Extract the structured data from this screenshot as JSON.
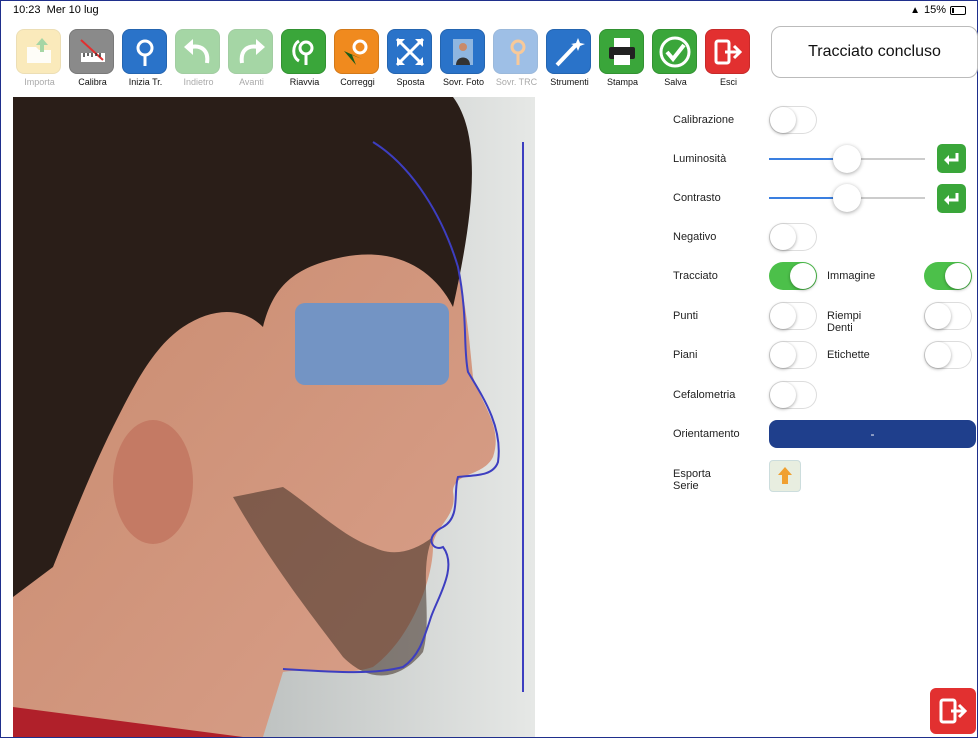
{
  "status": {
    "time": "10:23",
    "date": "Mer 10 lug",
    "wifi_icon": "wifi-icon",
    "battery": "15%"
  },
  "toolbar": [
    {
      "label": "Importa",
      "icon": "import-icon",
      "color": "#f5d26a",
      "enabled": false
    },
    {
      "label": "Calibra",
      "icon": "calibrate-ruler-icon",
      "color": "#8a8a8a",
      "enabled": true
    },
    {
      "label": "Inizia Tr.",
      "icon": "start-tracing-icon",
      "color": "#2a73c9",
      "enabled": true
    },
    {
      "label": "Indietro",
      "icon": "undo-arrow-icon",
      "color": "#3aa63a",
      "enabled": false
    },
    {
      "label": "Avanti",
      "icon": "redo-arrow-icon",
      "color": "#3aa63a",
      "enabled": false
    },
    {
      "label": "Riavvia",
      "icon": "restart-icon",
      "color": "#3aa63a",
      "enabled": true
    },
    {
      "label": "Correggi",
      "icon": "correct-cursor-icon",
      "color": "#f08a1e",
      "enabled": true
    },
    {
      "label": "Sposta",
      "icon": "move-arrows-icon",
      "color": "#2a73c9",
      "enabled": true
    },
    {
      "label": "Sovr. Foto",
      "icon": "overlay-photo-icon",
      "color": "#2a73c9",
      "enabled": true
    },
    {
      "label": "Sovr. TRC",
      "icon": "overlay-trace-icon",
      "color": "#2a73c9",
      "enabled": false
    },
    {
      "label": "Strumenti",
      "icon": "tools-wand-icon",
      "color": "#2a73c9",
      "enabled": true
    },
    {
      "label": "Stampa",
      "icon": "printer-icon",
      "color": "#3aa63a",
      "enabled": true
    },
    {
      "label": "Salva",
      "icon": "save-check-icon",
      "color": "#3aa63a",
      "enabled": true
    },
    {
      "label": "Esci",
      "icon": "exit-icon",
      "color": "#e23030",
      "enabled": true
    }
  ],
  "tracing_status": "Tracciato concluso",
  "panel": {
    "calibrazione": {
      "label": "Calibrazione",
      "on": false
    },
    "luminosita": {
      "label": "Luminosità",
      "value": 0.5
    },
    "contrasto": {
      "label": "Contrasto",
      "value": 0.5
    },
    "negativo": {
      "label": "Negativo",
      "on": false
    },
    "tracciato": {
      "label": "Tracciato",
      "on": true
    },
    "immagine": {
      "label": "Immagine",
      "on": true
    },
    "punti": {
      "label": "Punti",
      "on": false
    },
    "riempi_denti": {
      "label": "Riempi Denti",
      "on": false
    },
    "piani": {
      "label": "Piani",
      "on": false
    },
    "etichette": {
      "label": "Etichette",
      "on": false
    },
    "cefalometria": {
      "label": "Cefalometria",
      "on": false
    },
    "orientamento": {
      "label": "Orientamento",
      "value": "-"
    },
    "esporta": {
      "label": "Esporta Serie"
    }
  },
  "colors": {
    "accent_blue": "#1f3f8c",
    "toggle_on": "#4cc04a",
    "slider": "#3a7fe0",
    "exit_red": "#e23030",
    "face_mask": "#7394c4"
  }
}
